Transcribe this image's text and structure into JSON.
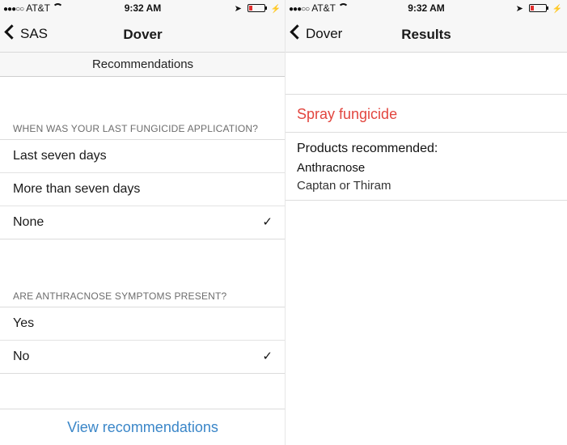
{
  "left_screen": {
    "status": {
      "carrier": "AT&T",
      "signal_dots": "●●●○○",
      "time": "9:32 AM"
    },
    "nav": {
      "back_label": "SAS",
      "title": "Dover"
    },
    "subheader": "Recommendations",
    "section1": {
      "header": "WHEN WAS YOUR LAST FUNGICIDE APPLICATION?",
      "options": [
        "Last seven days",
        "More than seven days",
        "None"
      ],
      "selected": "None"
    },
    "section2": {
      "header": "ARE ANTHRACNOSE SYMPTOMS PRESENT?",
      "options": [
        "Yes",
        "No"
      ],
      "selected": "No"
    },
    "button": "View recommendations"
  },
  "right_screen": {
    "status": {
      "carrier": "AT&T",
      "signal_dots": "●●●○○",
      "time": "9:32 AM"
    },
    "nav": {
      "back_label": "Dover",
      "title": "Results"
    },
    "result": "Spray fungicide",
    "products_label": "Products recommended:",
    "disease": "Anthracnose",
    "product": "Captan or Thiram"
  },
  "icons": {
    "check": "✓",
    "location": "➤",
    "charge": "⚡"
  },
  "colors": {
    "accent_red": "#e2463f",
    "accent_blue": "#3a86c8"
  }
}
